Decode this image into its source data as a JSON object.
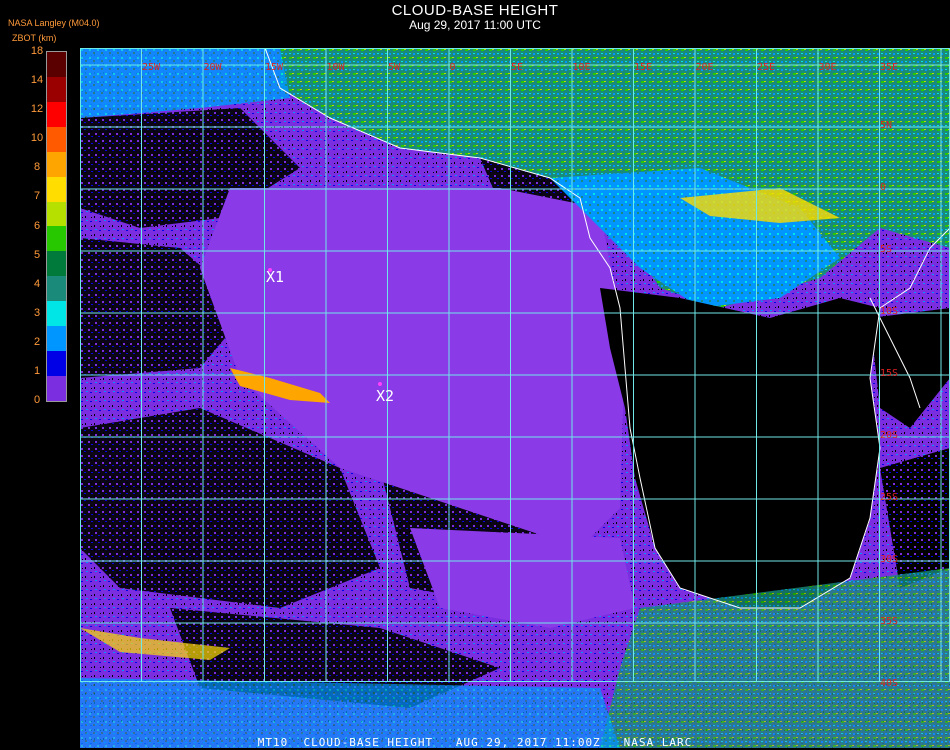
{
  "header": {
    "title": "CLOUD-BASE HEIGHT",
    "subtitle": "Aug 29, 2017 11:00 UTC",
    "producer": "NASA Langley (M04.0)",
    "unit_label": "ZBOT (km)"
  },
  "legend": {
    "ticks": [
      "18",
      "14",
      "12",
      "10",
      "8",
      "7",
      "6",
      "5",
      "4",
      "3",
      "2",
      "1",
      "0"
    ],
    "colors": [
      "#5a0000",
      "#9b0000",
      "#ff0000",
      "#ff5a00",
      "#ffa500",
      "#ffdd00",
      "#b5e000",
      "#28c800",
      "#007a3a",
      "#1a8a7a",
      "#00e6e6",
      "#0096ff",
      "#0000e6",
      "#7a2ee0"
    ]
  },
  "map": {
    "top_labels": [
      "25W",
      "20W",
      "15W",
      "10W",
      "5W",
      "0",
      "5E",
      "10E",
      "15E",
      "20E",
      "25E",
      "30E",
      "35E"
    ],
    "right_labels": [
      "5N",
      "0",
      "5S",
      "10S",
      "15S",
      "20S",
      "25S",
      "30S",
      "35S",
      "40S"
    ],
    "markers": [
      {
        "label": "X1"
      },
      {
        "label": "X2"
      }
    ],
    "colors": {
      "grid": "#6fe8e8",
      "ocean_cloud": "#7a2ee0",
      "land_clear": "#000000",
      "coast": "#ffffff",
      "marker": "#ff40ff"
    }
  },
  "footer": "MT10  CLOUD-BASE HEIGHT   AUG 29, 2017 11:00Z   NASA LARC"
}
